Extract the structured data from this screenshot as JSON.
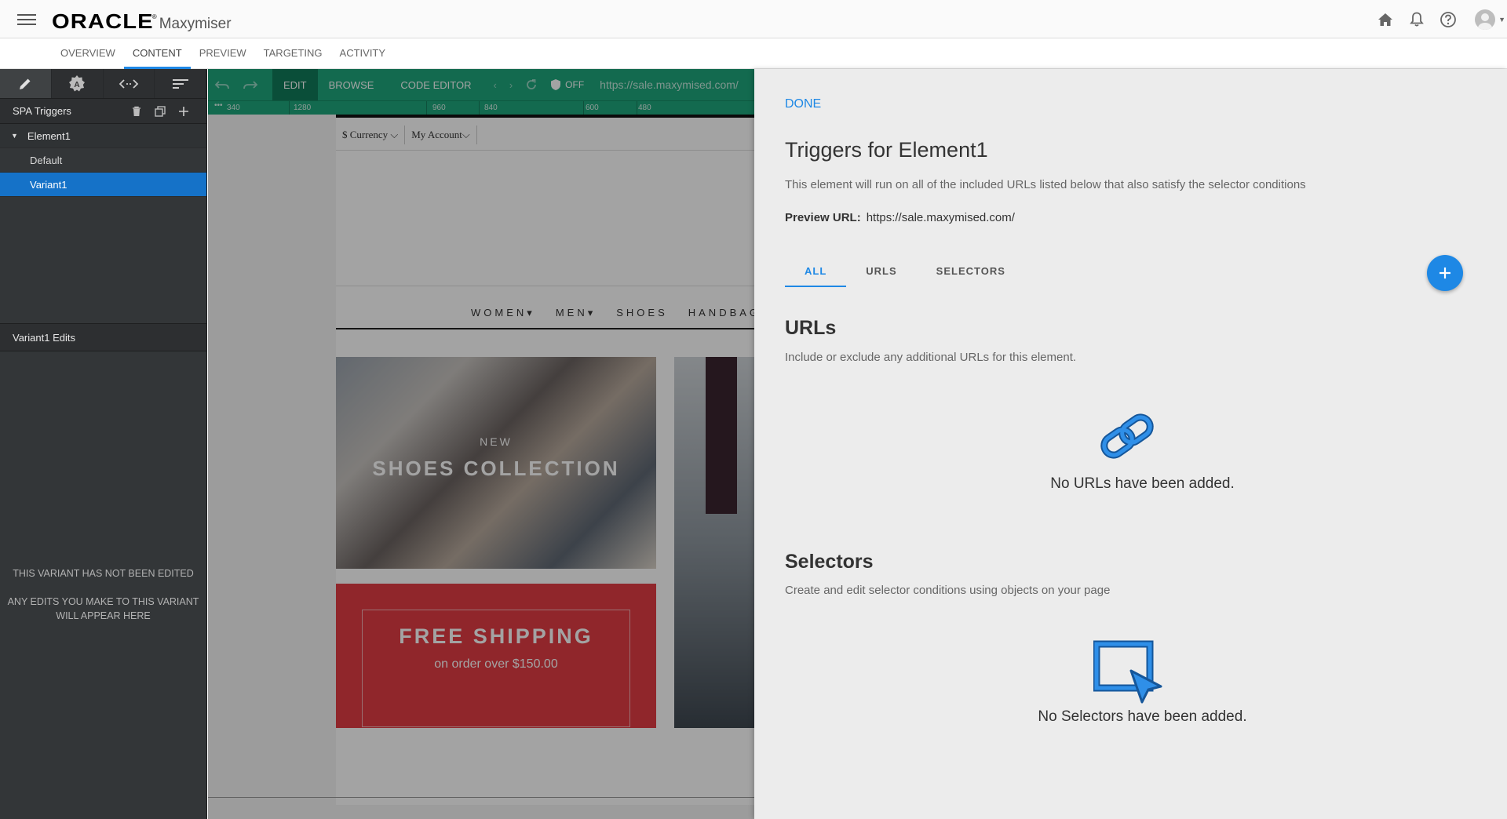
{
  "header": {
    "brand": "ORACLE",
    "brand_tm": "®",
    "product": "Maxymiser",
    "icons": [
      "home-icon",
      "bell-icon",
      "help-icon",
      "avatar"
    ]
  },
  "subnav": {
    "tabs": [
      {
        "label": "OVERVIEW"
      },
      {
        "label": "CONTENT"
      },
      {
        "label": "PREVIEW"
      },
      {
        "label": "TARGETING"
      },
      {
        "label": "ACTIVITY"
      }
    ],
    "active": "CONTENT"
  },
  "left_panel": {
    "toolbar_icons": [
      "pencil-icon",
      "style-badge-icon",
      "code-icon",
      "sort-icon"
    ],
    "section_title": "SPA Triggers",
    "tree": {
      "parent": "Element1",
      "children": [
        {
          "label": "Default"
        },
        {
          "label": "Variant1"
        }
      ]
    },
    "edits_title": "Variant1 Edits",
    "empty_line1": "THIS VARIANT HAS NOT BEEN EDITED",
    "empty_line2": "ANY EDITS YOU MAKE TO THIS VARIANT WILL APPEAR HERE"
  },
  "editor": {
    "buttons": {
      "edit": "EDIT",
      "browse": "BROWSE",
      "code": "CODE EDITOR",
      "off": "OFF"
    },
    "url": "https://sale.maxymised.com/",
    "ruler": [
      "340",
      "1280",
      "960",
      "840",
      "600",
      "480"
    ],
    "site": {
      "currency": "$ Currency",
      "account": "My Account",
      "nav": [
        "WOMEN",
        "MEN",
        "SHOES",
        "HANDBAGS"
      ],
      "banner1_kicker": "NEW",
      "banner1_title": "SHOES COLLECTION",
      "banner2_title": "FREE SHIPPING",
      "banner2_sub": "on order over $150.00"
    }
  },
  "drawer": {
    "done": "DONE",
    "title": "Triggers for Element1",
    "description": "This element will run on all of the included URLs listed below that also satisfy the selector conditions",
    "preview_label": "Preview URL:",
    "preview_url": "https://sale.maxymised.com/",
    "tabs": [
      {
        "label": "ALL"
      },
      {
        "label": "URLS"
      },
      {
        "label": "SELECTORS"
      }
    ],
    "urls": {
      "title": "URLs",
      "description": "Include or exclude any additional URLs for this element.",
      "empty": "No URLs have been added."
    },
    "selectors": {
      "title": "Selectors",
      "description": "Create and edit selector conditions using objects on your page",
      "empty": "No Selectors have been added."
    }
  },
  "colors": {
    "accent": "#1e88e5",
    "selected_row": "#1572c8",
    "editor_toolbar": "#1ea77c"
  }
}
